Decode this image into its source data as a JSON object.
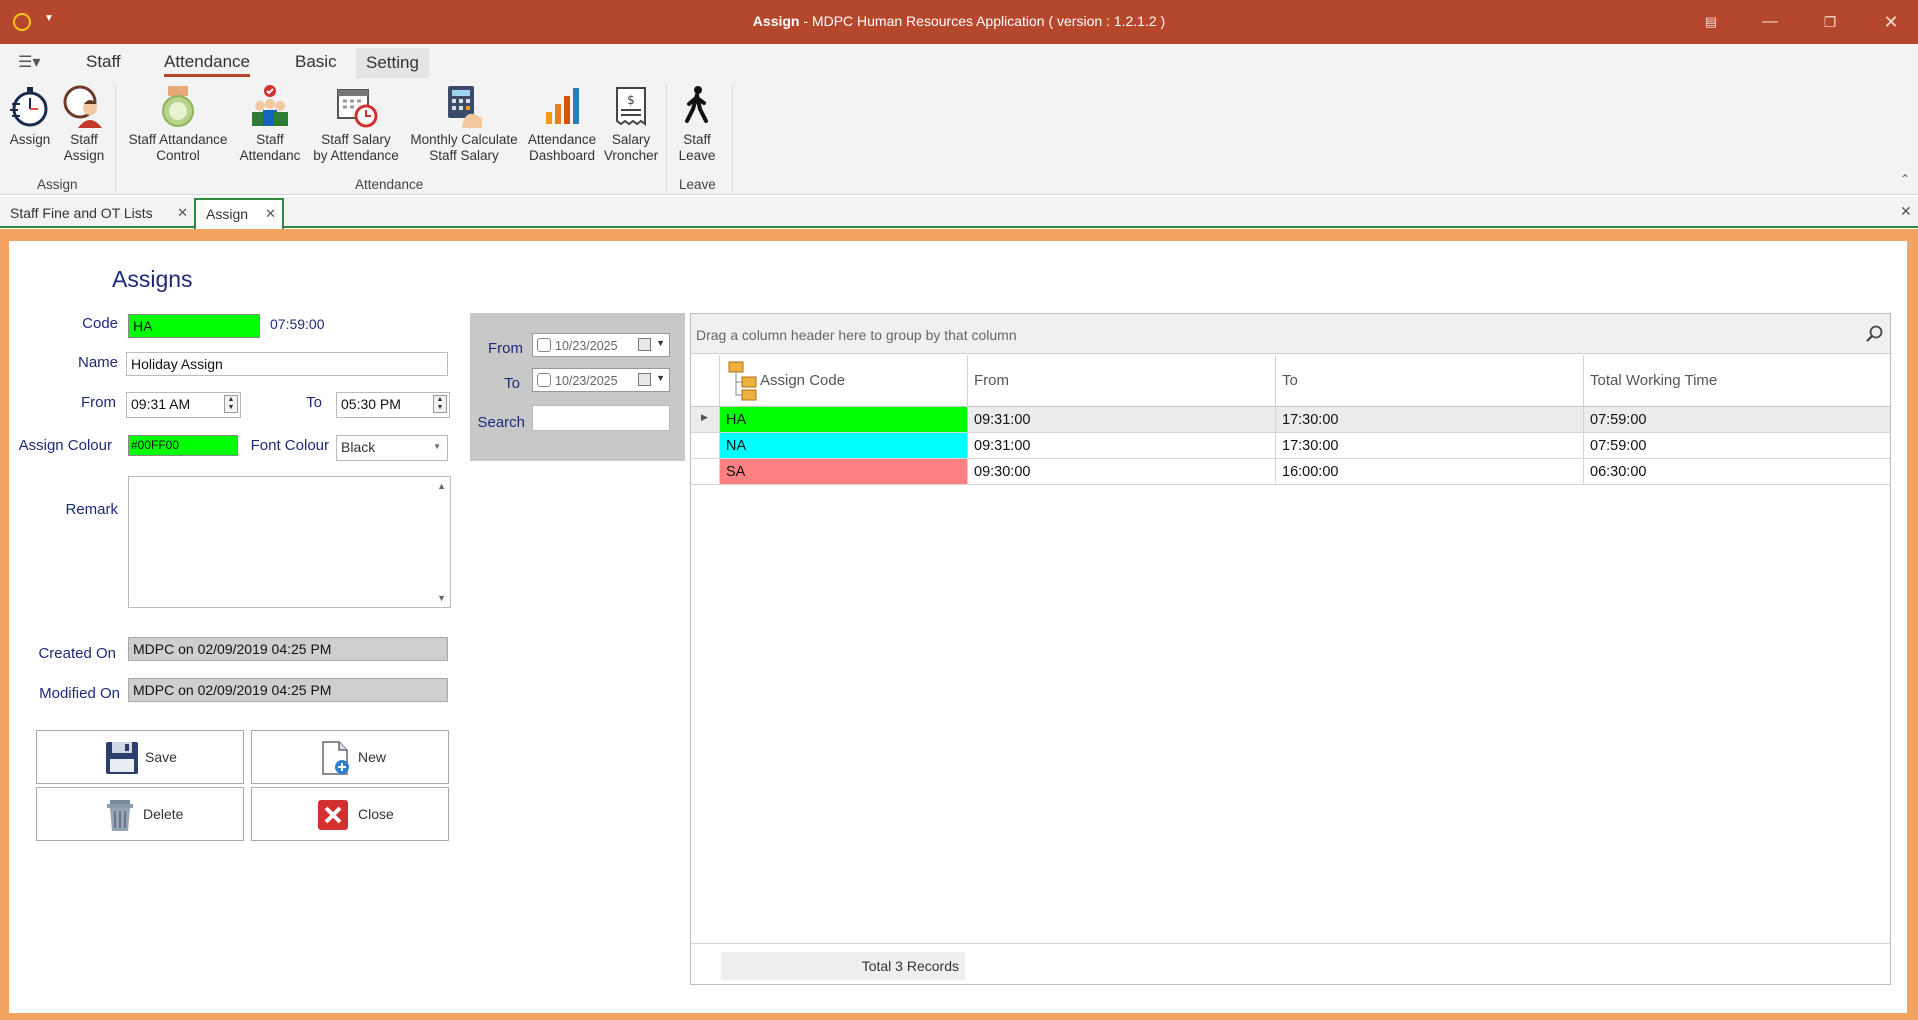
{
  "window": {
    "title_bold": "Assign",
    "title_rest": " - MDPC Human Resources Application ( version : 1.2.1.2 )"
  },
  "ribbon_tabs": [
    "Staff",
    "Attendance",
    "Basic",
    "Setting"
  ],
  "ribbon": {
    "buttons": [
      {
        "l1": "Assign",
        "l2": ""
      },
      {
        "l1": "Staff",
        "l2": "Assign"
      },
      {
        "l1": "Staff Attandance",
        "l2": "Control"
      },
      {
        "l1": "Staff",
        "l2": "Attendanc"
      },
      {
        "l1": "Staff Salary",
        "l2": "by Attendance"
      },
      {
        "l1": "Monthly Calculate",
        "l2": "Staff Salary"
      },
      {
        "l1": "Attendance",
        "l2": "Dashboard"
      },
      {
        "l1": "Salary",
        "l2": "Vroncher"
      },
      {
        "l1": "Staff",
        "l2": "Leave"
      }
    ],
    "groups": [
      "Assign",
      "Attendance",
      "Leave"
    ]
  },
  "doc_tabs": [
    "Staff Fine and OT Lists",
    "Assign"
  ],
  "form": {
    "heading": "Assigns",
    "code_label": "Code",
    "code_value": "HA",
    "code_time": "07:59:00",
    "name_label": "Name",
    "name_value": "Holiday Assign",
    "from_label": "From",
    "from_value": "09:31 AM",
    "to_label": "To",
    "to_value": "05:30 PM",
    "assign_colour_label": "Assign Colour",
    "assign_colour_value": "#00FF00",
    "font_colour_label": "Font Colour",
    "font_colour_value": "Black",
    "remark_label": "Remark",
    "remark_value": "",
    "created_label": "Created On",
    "created_value": "MDPC on 02/09/2019 04:25 PM",
    "modified_label": "Modified On",
    "modified_value": "MDPC on 02/09/2019 04:25 PM",
    "save_label": "Save",
    "new_label": "New",
    "delete_label": "Delete",
    "close_label": "Close"
  },
  "filter": {
    "from_label": "From",
    "from_date": "10/23/2025",
    "to_label": "To",
    "to_date": "10/23/2025",
    "search_label": "Search",
    "search_value": ""
  },
  "grid": {
    "group_hint": "Drag a column header here to group by that column",
    "columns": [
      "Assign Code",
      "From",
      "To",
      "Total Working Time"
    ],
    "rows": [
      {
        "code": "HA",
        "from": "09:31:00",
        "to": "17:30:00",
        "total": "07:59:00",
        "color": "#00ff00"
      },
      {
        "code": "NA",
        "from": "09:31:00",
        "to": "17:30:00",
        "total": "07:59:00",
        "color": "#00ffff"
      },
      {
        "code": "SA",
        "from": "09:30:00",
        "to": "16:00:00",
        "total": "06:30:00",
        "color": "#ff8080"
      }
    ],
    "footer": "Total 3 Records"
  },
  "colors": {
    "titlebar": "#b5482c",
    "frame": "#f4a460",
    "label_text": "#1e2a78",
    "active_tab_border": "#2f8a3b"
  }
}
